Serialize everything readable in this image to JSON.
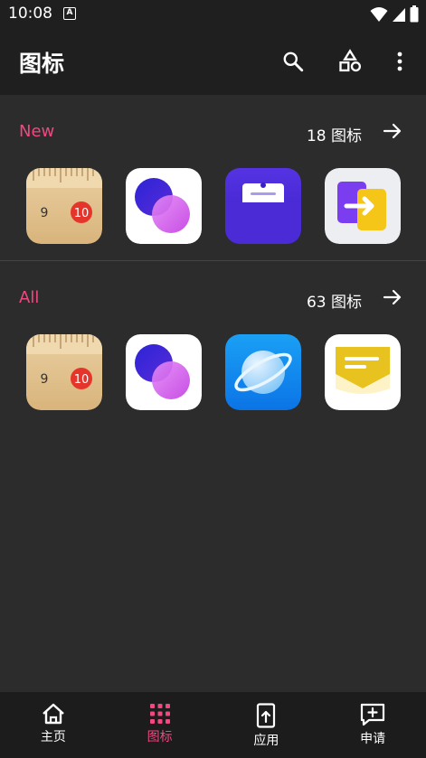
{
  "status": {
    "time": "10:08",
    "notif_glyph": "A"
  },
  "header": {
    "title": "图标",
    "actions": [
      "search-icon",
      "shapes-icon",
      "more-vert-icon"
    ]
  },
  "sections": [
    {
      "label": "New",
      "count": "18 图标",
      "icons": [
        "ruler-app-icon",
        "bubbles-app-icon",
        "pocket-app-icon",
        "transfer-app-icon"
      ]
    },
    {
      "label": "All",
      "count": "63 图标",
      "icons": [
        "ruler-app-icon",
        "bubbles-app-icon",
        "planet-browser-icon",
        "message-app-icon"
      ]
    }
  ],
  "ruler": {
    "num_a": "9",
    "num_b": "10"
  },
  "nav": {
    "items": [
      {
        "label": "主页",
        "icon": "home-icon",
        "active": false
      },
      {
        "label": "图标",
        "icon": "grid-icon",
        "active": true
      },
      {
        "label": "应用",
        "icon": "phone-upload-icon",
        "active": false
      },
      {
        "label": "申请",
        "icon": "request-add-icon",
        "active": false
      }
    ]
  },
  "colors": {
    "accent": "#f0487f",
    "background": "#2c2c2c",
    "bar": "#1f1f1f"
  }
}
